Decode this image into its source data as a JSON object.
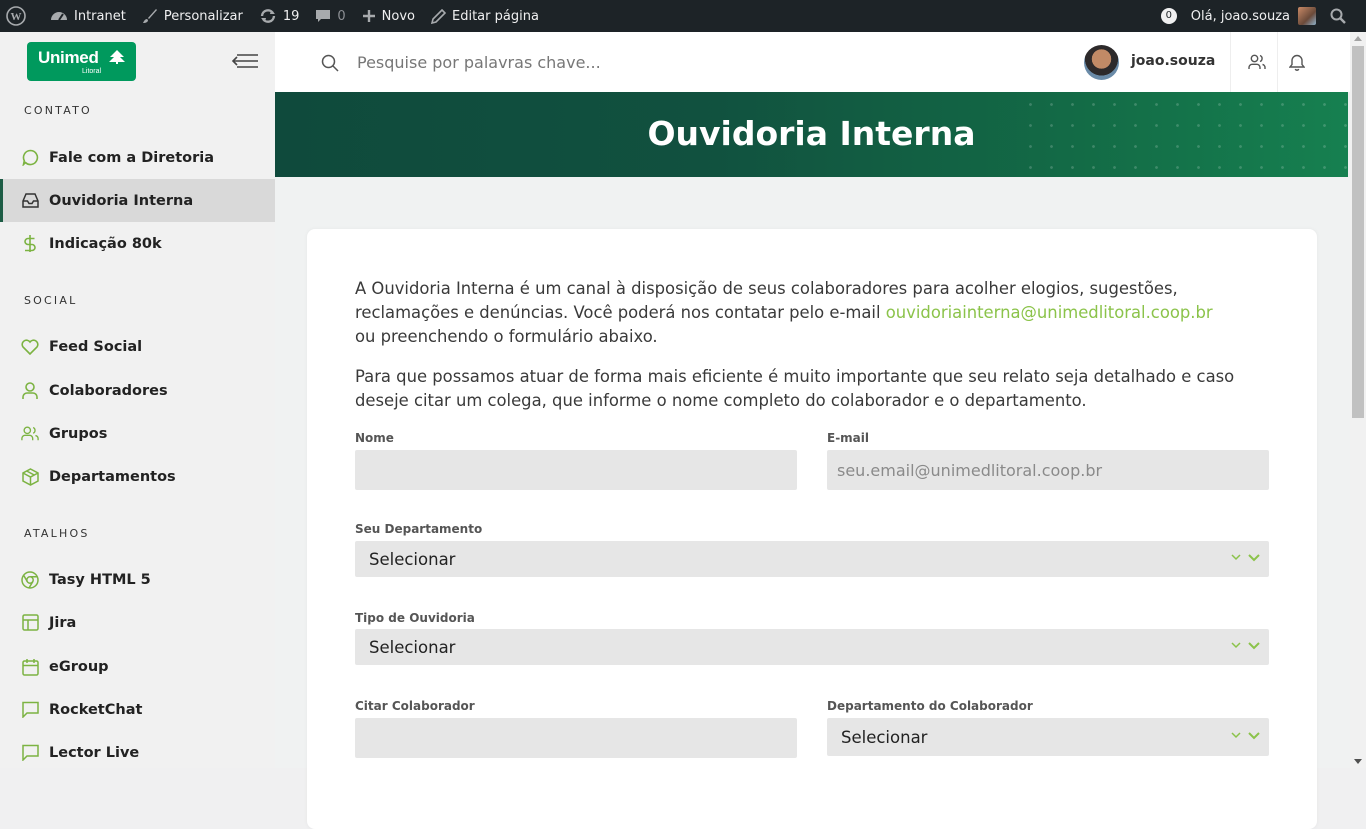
{
  "admin_bar": {
    "site_name": "Intranet",
    "customize": "Personalizar",
    "updates_count": "19",
    "comments_count": "0",
    "new": "Novo",
    "edit_page": "Editar página",
    "notifications_count": "0",
    "greeting": "Olá, joao.souza"
  },
  "sidebar": {
    "logo_name": "Unimed",
    "logo_sub": "Litoral",
    "sections": [
      {
        "title": "CONTATO",
        "items": [
          {
            "label": "Fale com a Diretoria",
            "icon": "message-circle-icon"
          },
          {
            "label": "Ouvidoria Interna",
            "icon": "inbox-icon",
            "active": true
          },
          {
            "label": "Indicação 80k",
            "icon": "dollar-icon"
          }
        ]
      },
      {
        "title": "SOCIAL",
        "items": [
          {
            "label": "Feed Social",
            "icon": "heart-icon"
          },
          {
            "label": "Colaboradores",
            "icon": "user-icon"
          },
          {
            "label": "Grupos",
            "icon": "users-icon"
          },
          {
            "label": "Departamentos",
            "icon": "box-icon"
          }
        ]
      },
      {
        "title": "ATALHOS",
        "items": [
          {
            "label": "Tasy HTML 5",
            "icon": "chrome-icon"
          },
          {
            "label": "Jira",
            "icon": "layout-icon"
          },
          {
            "label": "eGroup",
            "icon": "calendar-icon"
          },
          {
            "label": "RocketChat",
            "icon": "message-square-icon"
          },
          {
            "label": "Lector Live",
            "icon": "message-square-icon"
          }
        ]
      }
    ]
  },
  "header": {
    "search_placeholder": "Pesquise por palavras chave...",
    "username": "joao.souza"
  },
  "banner": {
    "title": "Ouvidoria Interna"
  },
  "content": {
    "intro_text": "A Ouvidoria Interna é um canal à disposição de seus colaboradores para acolher elogios, sugestões, reclamações e denúncias.  Você poderá nos contatar pelo e-mail ",
    "intro_email": "ouvidoriainterna@unimedlitoral.coop.br",
    "intro_tail": "  ou preenchendo o formulário abaixo.",
    "second_text": "Para que possamos atuar de forma mais eficiente é muito importante que seu relato seja detalhado  e caso deseje citar um colega, que informe o nome completo do colaborador e o departamento."
  },
  "form": {
    "nome_label": "Nome",
    "nome_value": "",
    "email_label": "E-mail",
    "email_placeholder": "seu.email@unimedlitoral.coop.br",
    "departamento_label": "Seu Departamento",
    "departamento_value": "Selecionar",
    "tipo_label": "Tipo de Ouvidoria",
    "tipo_value": "Selecionar",
    "citar_label": "Citar Colaborador",
    "citar_value": "",
    "dep_colab_label": "Departamento do Colaborador",
    "dep_colab_value": "Selecionar"
  },
  "colors": {
    "brand_green": "#00995d",
    "accent_lime": "#8bc34a",
    "banner_dark": "#0f4a3c",
    "admin_bar": "#1d2327"
  }
}
